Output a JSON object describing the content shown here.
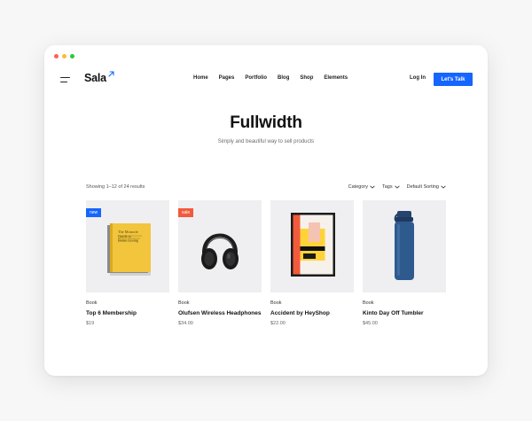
{
  "window": {
    "dots": [
      {
        "icon": "close-dot",
        "color": "#ff5f57"
      },
      {
        "icon": "minimize-dot",
        "color": "#febc2e"
      },
      {
        "icon": "zoom-dot",
        "color": "#28c840"
      }
    ]
  },
  "header": {
    "logo": "Sala",
    "nav": [
      "Home",
      "Pages",
      "Portfolio",
      "Blog",
      "Shop",
      "Elements"
    ],
    "login": "Log In",
    "cta": "Let's Talk",
    "accent": "#1565ff"
  },
  "hero": {
    "title": "Fullwidth",
    "subtitle": "Simply and beautiful way to sell products"
  },
  "toolbar": {
    "results": "Showing 1–12 of 24 results",
    "filters": [
      "Category",
      "Tags",
      "Default Sorting"
    ]
  },
  "products": [
    {
      "badge": "new",
      "badge_color": "#1565ff",
      "category": "Book",
      "name": "Top 6 Membership",
      "price": "$19",
      "image": "book",
      "book_text": "The Monocle Guide to Better Living"
    },
    {
      "badge": "sale",
      "badge_color": "#f25a3c",
      "category": "Book",
      "name": "Olufsen Wireless Headphones",
      "price": "$34.00",
      "image": "headphones"
    },
    {
      "badge": "",
      "badge_color": "",
      "category": "Book",
      "name": "Accident by HeyShop",
      "price": "$22.00",
      "image": "poster"
    },
    {
      "badge": "",
      "badge_color": "",
      "category": "Book",
      "name": "Kinto Day Off Tumbler",
      "price": "$45.00",
      "image": "tumbler"
    }
  ]
}
